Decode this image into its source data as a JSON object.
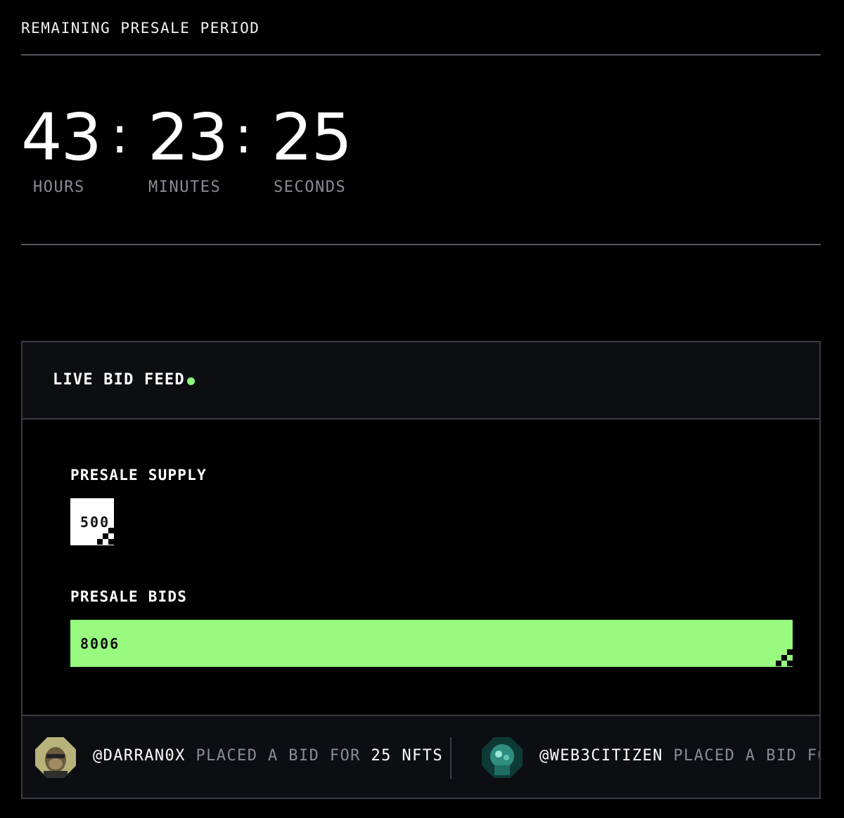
{
  "header": {
    "title": "REMAINING PRESALE PERIOD"
  },
  "countdown": {
    "hours": "43",
    "minutes": "23",
    "seconds": "25",
    "separator": ":",
    "hours_label": "HOURS",
    "minutes_label": "MINUTES",
    "seconds_label": "SECONDS"
  },
  "feed": {
    "title": "LIVE BID FEED",
    "live_color": "#8cf77a",
    "supply": {
      "label": "PRESALE SUPPLY",
      "value": "500"
    },
    "bids": {
      "label": "PRESALE BIDS",
      "value": "8006",
      "bar_color": "#98fb7f"
    },
    "items": [
      {
        "user": "@DARRAN0X",
        "action": "PLACED A BID FOR",
        "amount": "25 NFTS",
        "avatar_icon": "ape-avatar-icon"
      },
      {
        "user": "@WEB3CITIZEN",
        "action": "PLACED A BID FOR",
        "amount": "",
        "avatar_icon": "teal-creature-avatar-icon"
      }
    ]
  }
}
